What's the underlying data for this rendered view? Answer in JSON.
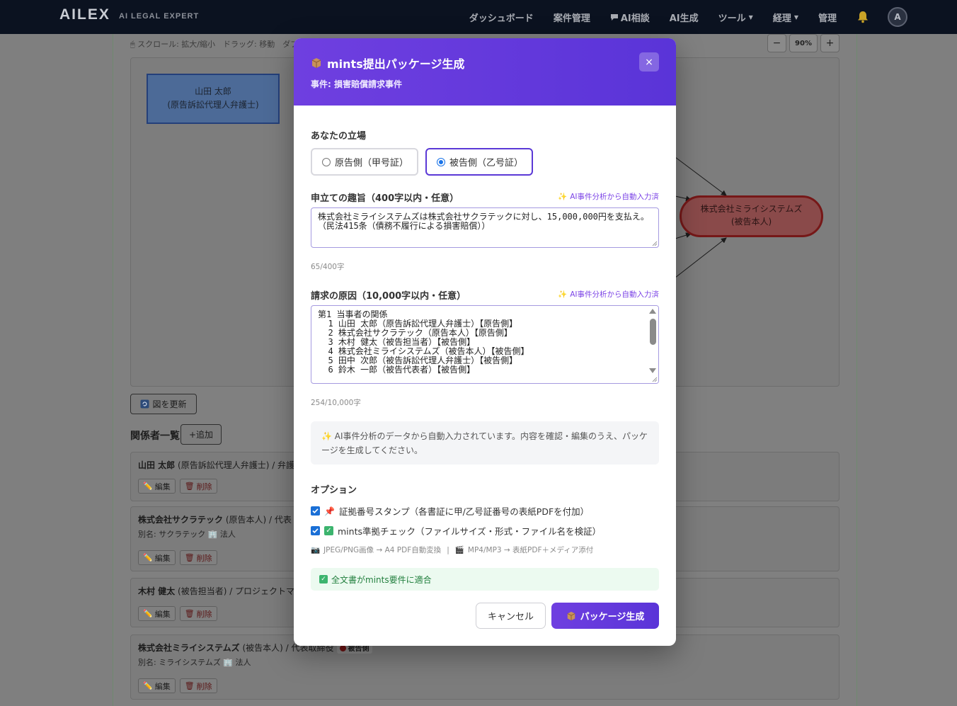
{
  "nav": {
    "logo": "AILEX",
    "logo_sub": "AI LEGAL EXPERT",
    "items": [
      "ダッシュボード",
      "案件管理",
      "AI相談",
      "AI生成",
      "ツール",
      "経理",
      "管理"
    ],
    "avatar": "A"
  },
  "background": {
    "hint": "🖱 スクロール: 拡大/縮小　ドラッグ: 移動　ダブ",
    "zoom_minus": "−",
    "zoom_level": "90%",
    "zoom_plus": "+",
    "node_plaintiff_name": "山田 太郎",
    "node_plaintiff_role": "(原告訴訟代理人弁護士)",
    "node_defendant_name": "株式会社ミライシステムズ",
    "node_defendant_role": "(被告本人)",
    "refresh_label": "図を更新",
    "section_title": "関係者一覧",
    "add_label": "+追加",
    "edit_label": "編集",
    "delete_label": "削除",
    "cards": [
      {
        "name": "山田 太郎",
        "role": "(原告訴訟代理人弁護士) / 弁護",
        "alias": ""
      },
      {
        "name": "株式会社サクラテック",
        "role": "(原告本人) / 代表",
        "alias": "別名: サクラテック 🏢 法人"
      },
      {
        "name": "木村 健太",
        "role": "(被告担当者) / プロジェクトマ",
        "alias": ""
      },
      {
        "name": "株式会社ミライシステムズ",
        "role": "(被告本人) / 代表取締役",
        "badge": "被告側",
        "alias": "別名: ミライシステムズ 🏢 法人"
      }
    ]
  },
  "modal": {
    "title": "mints提出パッケージ生成",
    "subtitle": "事件: 損害賠償請求事件",
    "close": "×",
    "position_label": "あなたの立場",
    "option_plaintiff": "原告側（甲号証）",
    "option_defendant": "被告側（乙号証）",
    "selected": "defendant",
    "claim_label": "申立ての趣旨（400字以内・任意）",
    "ai_note": "AI事件分析から自動入力済",
    "claim_text": "株式会社ミライシステムズは株式会社サクラテックに対し、15,000,000円を支払え。（民法415条（債務不履行による損害賠償））",
    "claim_count": "65/400字",
    "cause_label": "請求の原因（10,000字以内・任意）",
    "cause_lines": [
      "第1 当事者の関係",
      "  1 山田 太郎（原告訴訟代理人弁護士）【原告側】",
      "  2 株式会社サクラテック（原告本人）【原告側】",
      "  3 木村 健太（被告担当者）【被告側】",
      "  4 株式会社ミライシステムズ（被告本人）【被告側】",
      "  5 田中 次郎（被告訴訟代理人弁護士）【被告側】",
      "  6 鈴木 一郎（被告代表者）【被告側】"
    ],
    "cause_count": "254/10,000字",
    "info_text": "AI事件分析のデータから自動入力されています。内容を確認・編集のうえ、パッケージを生成してください。",
    "options_label": "オプション",
    "option1": "証拠番号スタンプ（各書証に甲/乙号証番号の表紙PDFを付加）",
    "option2": "mints準拠チェック（ファイルサイズ・形式・ファイル名を検証）",
    "note_jpeg": "JPEG/PNG画像 → A4 PDF自動変換",
    "note_sep": "|",
    "note_mp4": "MP4/MP3 → 表紙PDF＋メディア添付",
    "success_text": "全文書がmints要件に適合",
    "cancel": "キャンセル",
    "generate": "パッケージ生成"
  }
}
